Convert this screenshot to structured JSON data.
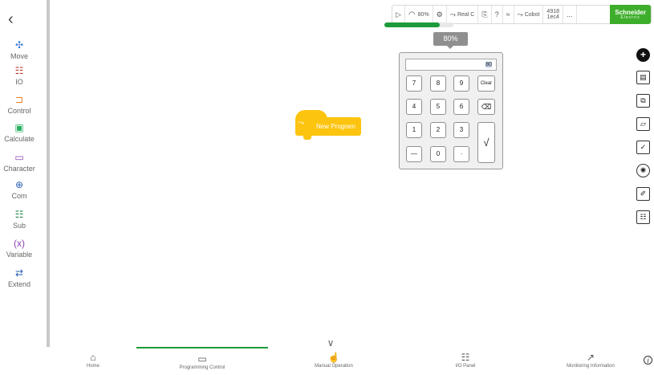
{
  "colors": {
    "accent": "#1d9b3a",
    "block": "#fdc40f",
    "brand": "#3dae2b"
  },
  "sidebar": {
    "back_icon": "chevron-left-icon",
    "items": [
      {
        "label": "Move",
        "icon": "move-arrows-icon"
      },
      {
        "label": "IO",
        "icon": "io-icon"
      },
      {
        "label": "Control",
        "icon": "control-icon"
      },
      {
        "label": "Calculate",
        "icon": "calculate-icon"
      },
      {
        "label": "Character",
        "icon": "character-icon"
      },
      {
        "label": "Com",
        "icon": "globe-icon"
      },
      {
        "label": "Sub",
        "icon": "grid-icon"
      },
      {
        "label": "Variable",
        "icon": "variable-icon"
      },
      {
        "label": "Extend",
        "icon": "extend-icon"
      }
    ]
  },
  "topbar": {
    "speed": "80%",
    "mode": "Real C",
    "help": "?",
    "robot": "Cobot",
    "robot_id_line1": "4918",
    "robot_id_line2": "1ec4",
    "more": "...",
    "brand": "Schneider",
    "brand_sub": "Electric"
  },
  "progress": {
    "value": 0.8
  },
  "speed_tooltip": "80%",
  "keypad": {
    "display": "80",
    "keys": [
      "7",
      "8",
      "9",
      "Clear",
      "4",
      "5",
      "6",
      "⌫",
      "1",
      "2",
      "3",
      "√",
      "—",
      "0",
      "·"
    ]
  },
  "block": {
    "label": "New Program"
  },
  "right_tools": [
    "add-icon",
    "save-icon",
    "save-as-icon",
    "open-folder-icon",
    "check-icon",
    "debug-icon",
    "lock-icon",
    "calculator-icon"
  ],
  "bottomnav": {
    "tabs": [
      {
        "label": "Home",
        "icon": "home-icon"
      },
      {
        "label": "Programming Control",
        "icon": "monitor-icon"
      },
      {
        "label": "Manual Operation",
        "icon": "hand-icon"
      },
      {
        "label": "I/O Panel",
        "icon": "sliders-icon"
      },
      {
        "label": "Monitoring Information",
        "icon": "chart-icon"
      }
    ],
    "active_tab": 1
  }
}
